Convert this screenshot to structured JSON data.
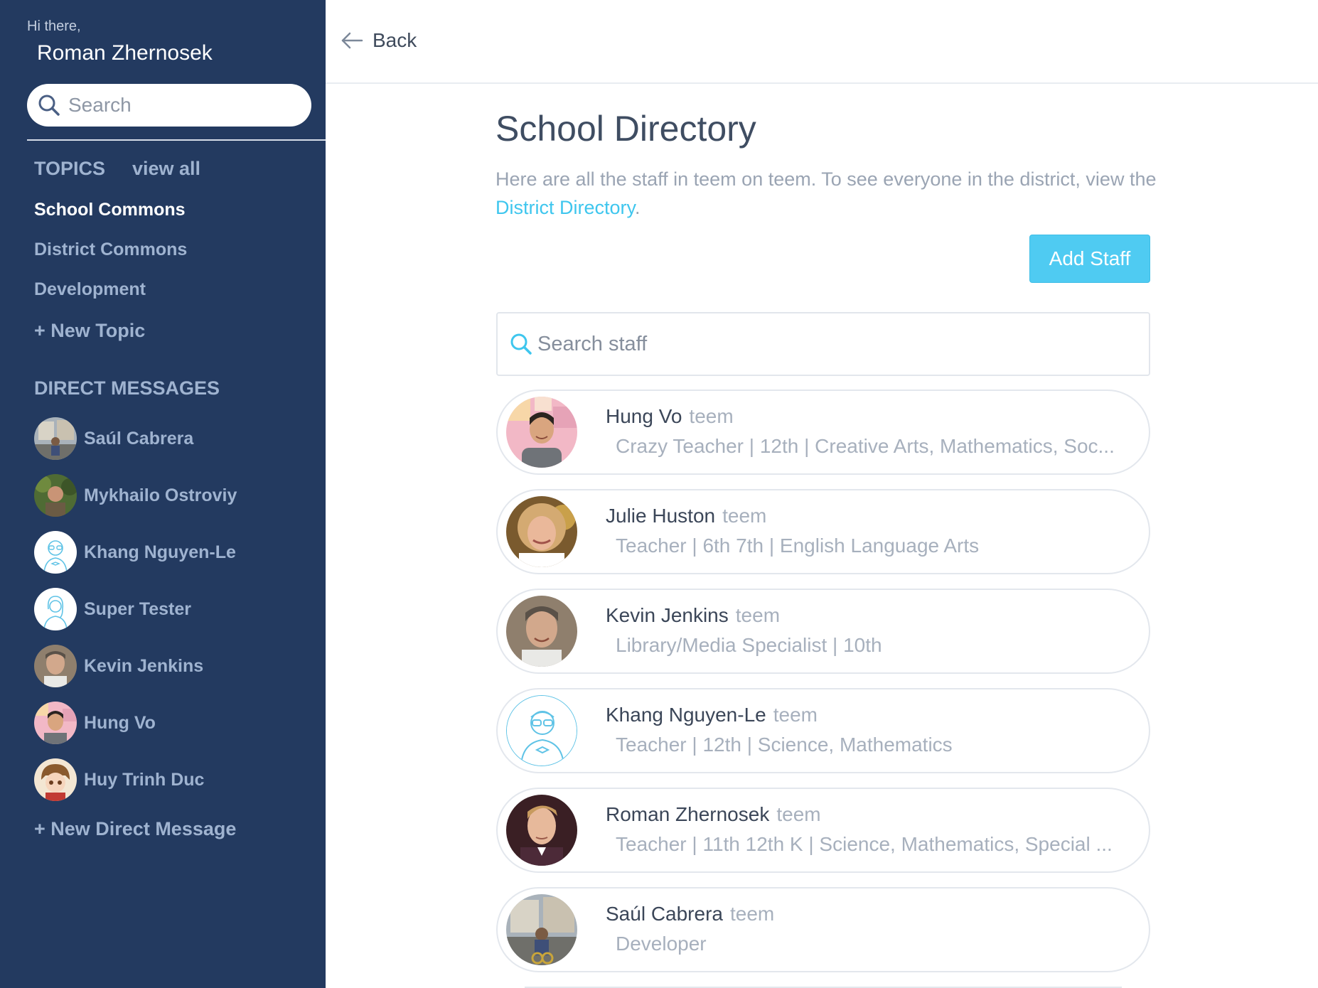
{
  "sidebar": {
    "greeting": "Hi there,",
    "user_name": "Roman Zhernosek",
    "search_placeholder": "Search",
    "topics_heading": "TOPICS",
    "view_all": "view all",
    "topics": [
      {
        "label": "School Commons",
        "active": true
      },
      {
        "label": "District Commons",
        "active": false
      },
      {
        "label": "Development",
        "active": false
      }
    ],
    "new_topic": "+ New Topic",
    "dm_heading": "DIRECT MESSAGES",
    "direct_messages": [
      {
        "name": "Saúl Cabrera",
        "avatar": "photo-street"
      },
      {
        "name": "Mykhailo Ostroviy",
        "avatar": "photo-outdoor"
      },
      {
        "name": "Khang Nguyen-Le",
        "avatar": "illustration-man-icon"
      },
      {
        "name": "Super Tester",
        "avatar": "illustration-woman-icon"
      },
      {
        "name": "Kevin Jenkins",
        "avatar": "photo-portrait"
      },
      {
        "name": "Hung Vo",
        "avatar": "photo-portrait-pink"
      },
      {
        "name": "Huy Trinh Duc",
        "avatar": "cartoon-avatar"
      }
    ],
    "new_dm": "+ New Direct Message"
  },
  "header": {
    "back_label": "Back"
  },
  "main": {
    "title": "School Directory",
    "intro_text": "Here are all the staff in teem on teem. To see everyone in the district, view the ",
    "intro_link": "District Directory",
    "intro_end": ".",
    "add_staff_label": "Add Staff",
    "search_placeholder": "Search staff",
    "staff": [
      {
        "name": "Hung Vo",
        "org": "teem",
        "description": "Crazy Teacher | 12th | Creative Arts, Mathematics, Soc..."
      },
      {
        "name": "Julie Huston",
        "org": "teem",
        "description": "Teacher | 6th 7th | English Language Arts"
      },
      {
        "name": "Kevin Jenkins",
        "org": "teem",
        "description": "Library/Media Specialist | 10th"
      },
      {
        "name": "Khang Nguyen-Le",
        "org": "teem",
        "description": "Teacher | 12th | Science, Mathematics"
      },
      {
        "name": "Roman Zhernosek",
        "org": "teem",
        "description": "Teacher | 11th 12th K | Science, Mathematics, Special ..."
      },
      {
        "name": "Saúl Cabrera",
        "org": "teem",
        "description": "Developer"
      }
    ]
  },
  "colors": {
    "sidebar_bg": "#233a60",
    "sidebar_text": "#9fb3d0",
    "accent": "#4fcbf2",
    "link": "#3ec6ee"
  }
}
